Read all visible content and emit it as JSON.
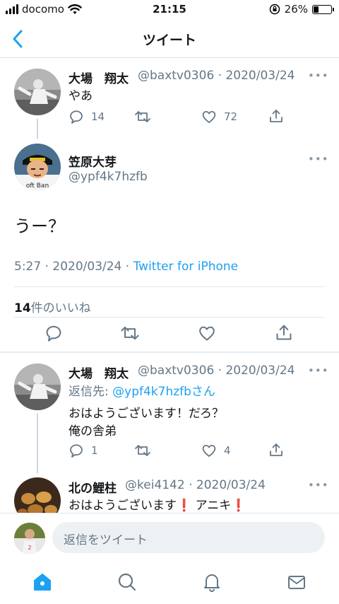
{
  "status_bar": {
    "carrier": "docomo",
    "time": "21:15",
    "battery": "26%",
    "battery_level": 0.26
  },
  "nav": {
    "title": "ツイート"
  },
  "tweet1": {
    "name": "大場　翔太",
    "meta": "@baxtv0306 · 2020/03/24",
    "text": "やあ",
    "replies": "14",
    "likes": "72",
    "more": "•••"
  },
  "main_tweet": {
    "name": "笠原大芽",
    "handle": "@ypf4k7hzfb",
    "text": "うー？",
    "time": "5:27 · 2020/03/24 · ",
    "source": "Twitter for iPhone",
    "likes_count": "14",
    "likes_label": "件のいいね",
    "more": "•••"
  },
  "reply1": {
    "name": "大場　翔太",
    "meta": "@baxtv0306 · 2020/03/24",
    "reply_to_label": "返信先: ",
    "reply_to_handle": "@ypf4k7hzfbさん",
    "line1": "おはようございます！だろ？",
    "line2": "俺の舎弟",
    "replies": "1",
    "likes": "4",
    "more": "•••"
  },
  "reply2": {
    "name": "北の鯉柱",
    "meta": "@kei4142 · 2020/03/24",
    "text_a": "おはようございます",
    "exclaim": "❗",
    "text_b": " アニキ",
    "more": "•••"
  },
  "reply_bar": {
    "placeholder": "返信をツイート"
  },
  "tabs": [
    "home-icon",
    "search-icon",
    "notifications-icon",
    "messages-icon"
  ],
  "colors": {
    "accent": "#1da1f2",
    "secondary": "#657786",
    "text": "#14171a"
  }
}
